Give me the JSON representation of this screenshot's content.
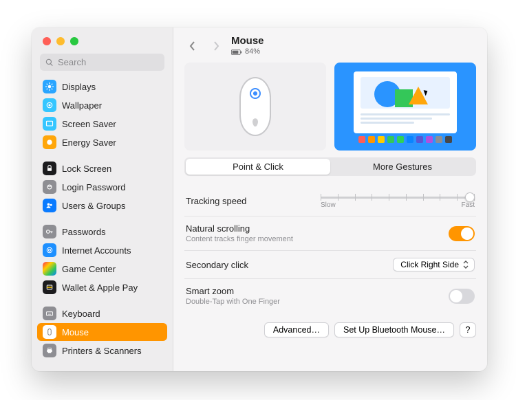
{
  "search": {
    "placeholder": "Search"
  },
  "sidebar": {
    "sections": [
      {
        "items": [
          {
            "label": "Displays"
          },
          {
            "label": "Wallpaper"
          },
          {
            "label": "Screen Saver"
          },
          {
            "label": "Energy Saver"
          }
        ]
      },
      {
        "items": [
          {
            "label": "Lock Screen"
          },
          {
            "label": "Login Password"
          },
          {
            "label": "Users & Groups"
          }
        ]
      },
      {
        "items": [
          {
            "label": "Passwords"
          },
          {
            "label": "Internet Accounts"
          },
          {
            "label": "Game Center"
          },
          {
            "label": "Wallet & Apple Pay"
          }
        ]
      },
      {
        "items": [
          {
            "label": "Keyboard"
          },
          {
            "label": "Mouse"
          },
          {
            "label": "Printers & Scanners"
          }
        ]
      }
    ]
  },
  "header": {
    "title": "Mouse",
    "battery": "84%"
  },
  "tabs": {
    "point_click": "Point & Click",
    "more_gestures": "More Gestures"
  },
  "tracking": {
    "label": "Tracking speed",
    "min": "Slow",
    "max": "Fast"
  },
  "natural": {
    "label": "Natural scrolling",
    "sub": "Content tracks finger movement"
  },
  "secondary": {
    "label": "Secondary click",
    "value": "Click Right Side"
  },
  "zoom": {
    "label": "Smart zoom",
    "sub": "Double-Tap with One Finger"
  },
  "footer": {
    "advanced": "Advanced…",
    "bluetooth": "Set Up Bluetooth Mouse…",
    "help": "?"
  },
  "dock_colors": [
    "#ff5f57",
    "#ff9500",
    "#ffcc00",
    "#34c759",
    "#30d158",
    "#0a84ff",
    "#5856d6",
    "#af52de",
    "#8e8e93",
    "#48484a"
  ]
}
